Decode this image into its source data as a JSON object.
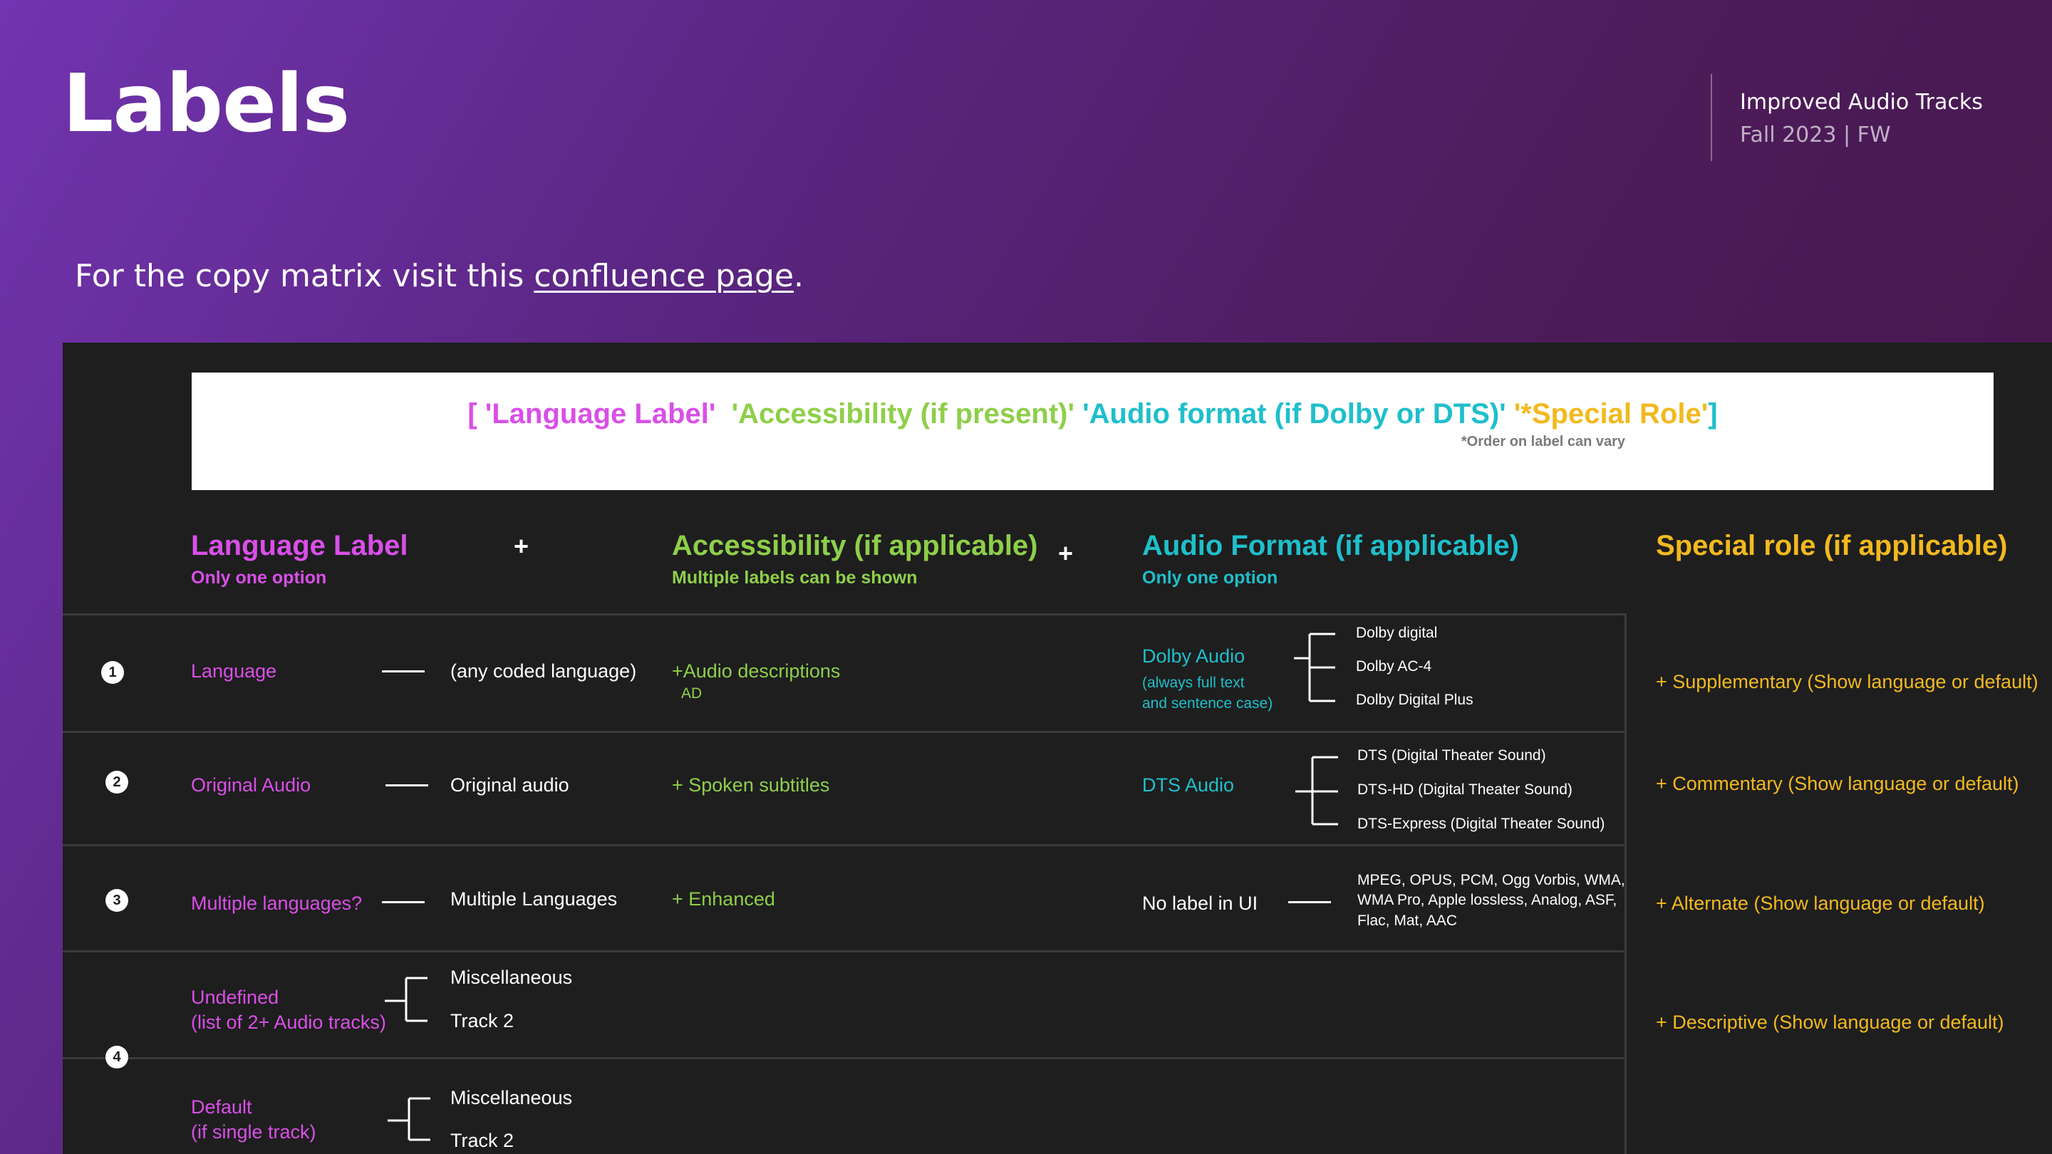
{
  "header": {
    "title": "Labels",
    "project": "Improved Audio Tracks",
    "subtitle": "Fall 2023 | FW"
  },
  "intro": {
    "prefix": "For the copy matrix visit this ",
    "link": "confluence page",
    "suffix": "."
  },
  "formula": {
    "open": "[ ",
    "language": "'Language Label'",
    "accessibility": "'Accessibility (if present)'",
    "audio_format": "'Audio format (if Dolby or DTS)'",
    "special_prefix": "'*",
    "special": "Special Role'",
    "close": "]",
    "note": "*Order on label can vary"
  },
  "columns": {
    "language": {
      "title": "Language Label",
      "sub": "Only one option"
    },
    "accessibility": {
      "title": "Accessibility (if applicable)",
      "sub": "Multiple labels can be shown"
    },
    "audio_format": {
      "title": "Audio Format (if applicable)",
      "sub": "Only one option"
    },
    "special": {
      "title": "Special role (if applicable)"
    },
    "plus": "+"
  },
  "rows": {
    "r1": {
      "num": "1",
      "lang": "Language",
      "value": "(any coded language)",
      "access": "+Audio descriptions",
      "access_code": "AD",
      "format": "Dolby Audio",
      "format_note1": "(always full text",
      "format_note2": "and sentence case)",
      "options": [
        "Dolby digital",
        "Dolby AC-4",
        "Dolby Digital Plus"
      ],
      "special": "+ Supplementary (Show language or default)"
    },
    "r2": {
      "num": "2",
      "lang": "Original Audio",
      "value": "Original audio",
      "access": "+ Spoken subtitles",
      "format": "DTS Audio",
      "options": [
        "DTS (Digital Theater Sound)",
        "DTS-HD (Digital Theater Sound)",
        "DTS-Express (Digital Theater Sound)"
      ],
      "special": "+ Commentary (Show language or default)"
    },
    "r3": {
      "num": "3",
      "lang": "Multiple languages?",
      "value": "Multiple Languages",
      "access": "+ Enhanced",
      "format": "No label in UI",
      "options": [
        "MPEG, OPUS, PCM, Ogg Vorbis, WMA,",
        "WMA Pro, Apple lossless, Analog, ASF,",
        "Flac, Mat,  AAC"
      ],
      "special": "+ Alternate (Show language or default)"
    },
    "r4": {
      "num": "4",
      "undefined_line1": "Undefined",
      "undefined_line2": "(list of 2+ Audio tracks)",
      "undefined_opt1": "Miscellaneous",
      "undefined_opt2": "Track 2",
      "default_line1": "Default",
      "default_line2": "(if single track)",
      "default_opt1": "Miscellaneous",
      "default_opt2": "Track 2",
      "special": "+ Descriptive (Show language or default)"
    }
  },
  "colors": {
    "pink": "#d94fe8",
    "green": "#8ecf4a",
    "cyan": "#1fbfcb",
    "yellow": "#f2b91f",
    "panel": "#1e1e1e"
  }
}
